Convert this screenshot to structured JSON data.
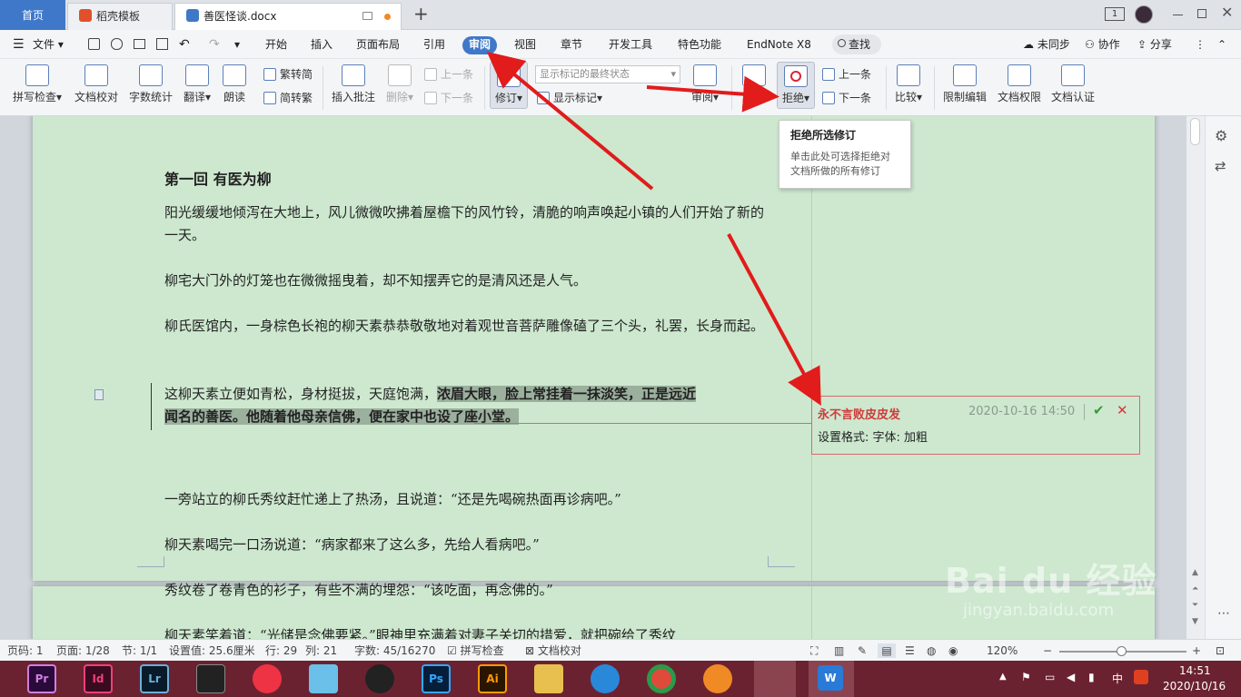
{
  "tabs": {
    "home": "首页",
    "templates": "稻壳模板",
    "document": "善医怪谈.docx",
    "new_tab": "+"
  },
  "window": {
    "badge": "1"
  },
  "menu": {
    "file": "文件",
    "items": [
      "开始",
      "插入",
      "页面布局",
      "引用",
      "审阅",
      "视图",
      "章节",
      "开发工具",
      "特色功能",
      "EndNote X8"
    ],
    "search": "查找",
    "sync": "未同步",
    "collab": "协作",
    "share": "分享"
  },
  "ribbon": {
    "spell": "拼写检查",
    "doc_check": "文档校对",
    "word_count": "字数统计",
    "translate": "翻译",
    "read_aloud": "朗读",
    "to_trad": "繁转简",
    "to_simp": "简转繁",
    "insert_comment": "插入批注",
    "delete": "删除",
    "prev1": "上一条",
    "next1": "下一条",
    "revise": "修订",
    "markup_state": "显示标记的最终状态",
    "show_markup": "显示标记",
    "review": "审阅",
    "accept": "接受",
    "reject": "拒绝",
    "prev2": "上一条",
    "next2": "下一条",
    "compare": "比较",
    "restrict_edit": "限制编辑",
    "doc_rights": "文档权限",
    "doc_cert": "文档认证"
  },
  "tooltip": {
    "title": "拒绝所选修订",
    "desc": "单击此处可选择拒绝对文档所做的所有修订"
  },
  "document": {
    "heading": "第一回  有医为柳",
    "p1": "阳光缓缓地倾泻在大地上，风儿微微吹拂着屋檐下的风竹铃，清脆的响声唤起小镇的人们开始了新的一天。",
    "p2": "柳宅大门外的灯笼也在微微摇曳着，却不知摆弄它的是清风还是人气。",
    "p3": "柳氏医馆内，一身棕色长袍的柳天素恭恭敬敬地对着观世音菩萨雕像磕了三个头，礼罢，长身而起。",
    "p4_plain": "这柳天素立便如青松，身材挺拔，天庭饱满，",
    "p4_bold1": "浓眉大眼，脸上常挂着一抹淡笑，正是远近",
    "p4_bold2": "闻名的善医。他随着他母亲信佛，便在家中也设了座小堂。",
    "p5": "一旁站立的柳氏秀纹赶忙递上了热汤，且说道：“还是先喝碗热面再诊病吧。”",
    "p6": "柳天素喝完一口汤说道：“病家都来了这么多，先给人看病吧。”",
    "p7": "秀纹卷了卷青色的衫子，有些不满的埋怨：“该吃面，再念佛的。”",
    "p8": "柳天素笑着道：“光储是念佛要紧。”眼神里充满着对妻子关切的措爱，就把碗给了秀纹"
  },
  "comment": {
    "author": "永不言败皮皮发",
    "time": "2020-10-16 14:50",
    "text": "设置格式: 字体: 加粗"
  },
  "status": {
    "page_num": "页码: 1",
    "page": "页面: 1/28",
    "section": "节: 1/1",
    "setting": "设置值: 25.6厘米",
    "row": "行: 29",
    "col": "列: 21",
    "words": "字数: 45/16270",
    "spell": "拼写检查",
    "doc_check": "文档校对",
    "zoom": "120%"
  },
  "taskbar": {
    "apps": [
      "Pr",
      "Id",
      "Lr",
      "Ps",
      "Ai"
    ],
    "clock_time": "14:51",
    "clock_date": "2020/10/16",
    "ime": "中"
  },
  "watermark": {
    "logo": "Bai du 经验",
    "url": "jingyan.baidu.com"
  },
  "colors": {
    "accent": "#3f78c8",
    "page_bg": "#cde8cf",
    "comment_border": "#d86a6a",
    "comment_author": "#d03b3b",
    "arrow": "#e21b1b",
    "taskbar": "#6b2230"
  }
}
